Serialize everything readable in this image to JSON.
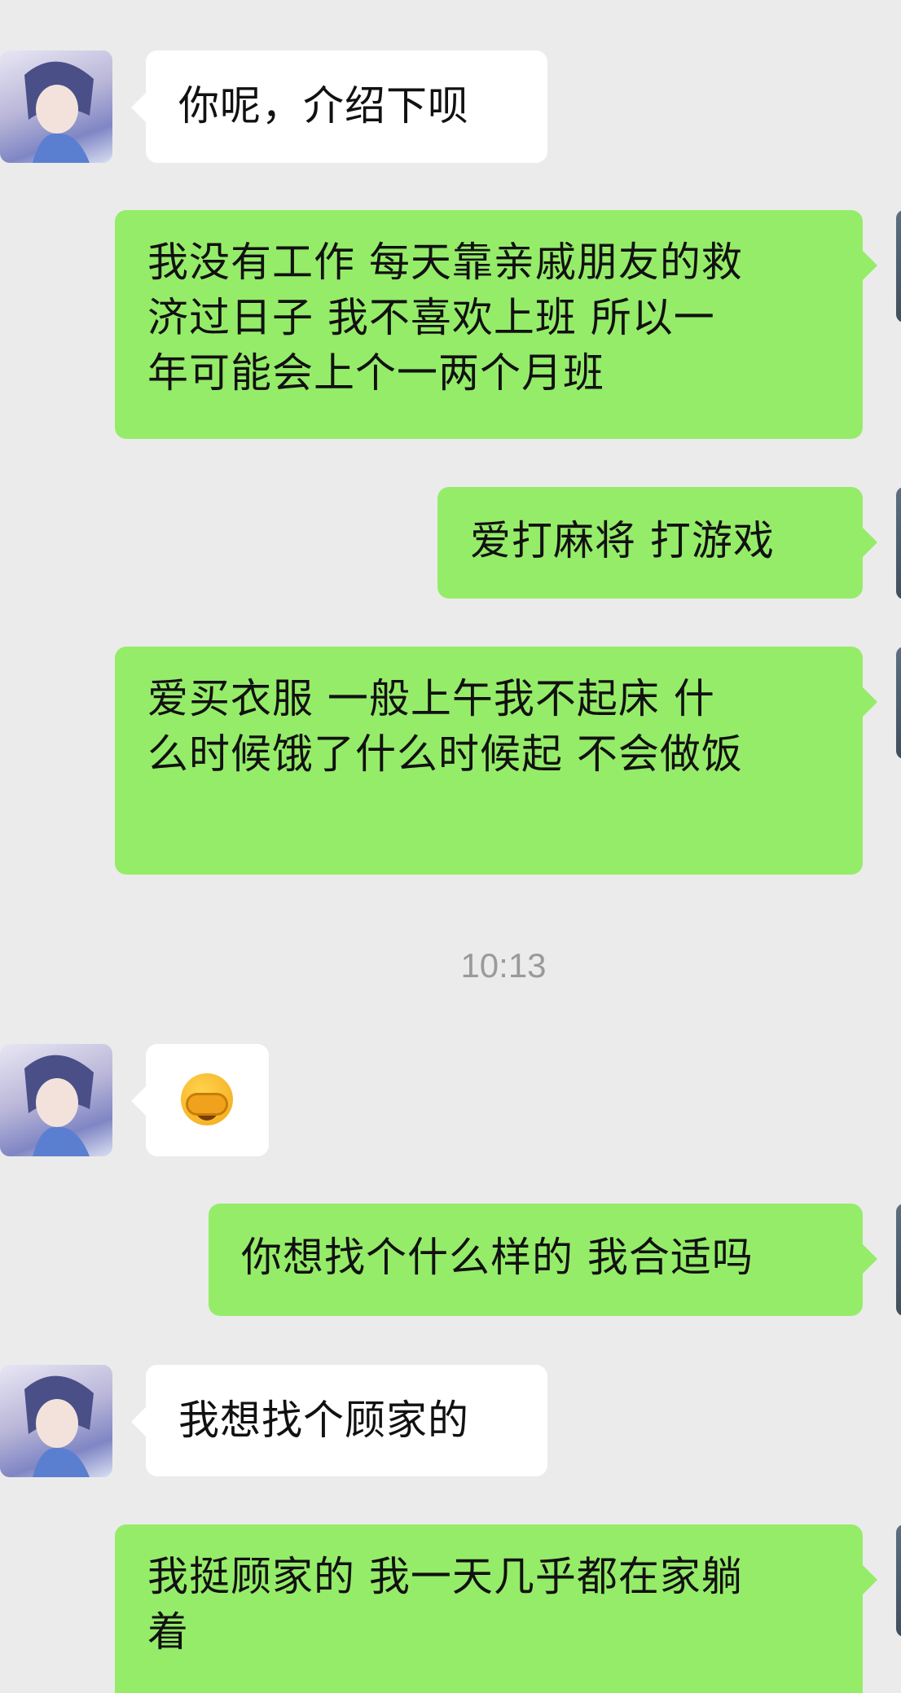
{
  "messages": [
    {
      "from": "other",
      "text": "你呢，介绍下呗"
    },
    {
      "from": "self",
      "text": "我没有工作 每天靠亲戚朋友的救\n济过日子 我不喜欢上班 所以一\n年可能会上个一两个月班"
    },
    {
      "from": "self",
      "text": "爱打麻将 打游戏"
    },
    {
      "from": "self",
      "text": "爱买衣服 一般上午我不起床 什\n么时候饿了什么时候起 不会做饭"
    },
    {
      "from": "other",
      "emoji": "facepalm-emoji"
    },
    {
      "from": "self",
      "text": "你想找个什么样的 我合适吗"
    },
    {
      "from": "other",
      "text": "我想找个顾家的"
    },
    {
      "from": "self",
      "text": "我挺顾家的 我一天几乎都在家躺\n着"
    }
  ],
  "timestamp": "10:13",
  "colors": {
    "background": "#ebebeb",
    "self_bubble": "#95ec69",
    "other_bubble": "#ffffff"
  }
}
